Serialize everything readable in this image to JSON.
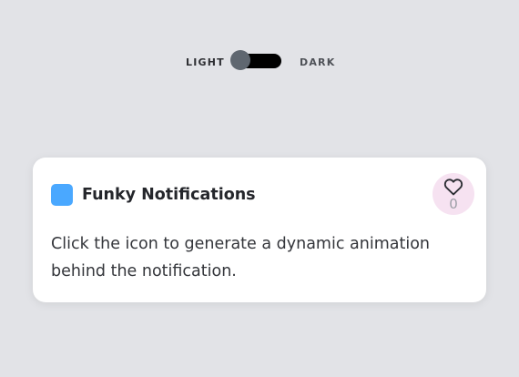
{
  "theme_toggle": {
    "light_label": "LIGHT",
    "dark_label": "DARK",
    "selected": "light"
  },
  "notification": {
    "title": "Funky Notifications",
    "body": "Click the icon to generate a dynamic animation behind the notification.",
    "like_count": "0",
    "icon_color": "#4aa8ff",
    "like_bg_color": "#f6e2f1"
  },
  "colors": {
    "background": "#e2e3e7",
    "card": "#ffffff",
    "toggle_track": "#000000",
    "toggle_knob": "#5f6770"
  },
  "icons": {
    "app": "square-app-icon",
    "like": "heart-outline-icon"
  }
}
